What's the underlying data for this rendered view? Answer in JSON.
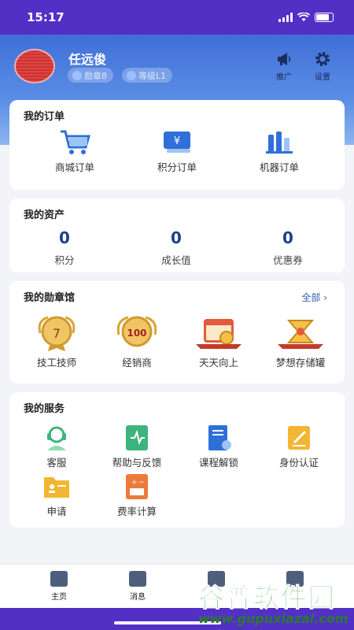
{
  "status_bar": {
    "time": "15:17"
  },
  "profile": {
    "name": "任远俊",
    "badge_pill": "勋章8",
    "level_pill": "等级L1",
    "promote_label": "推广",
    "settings_label": "设置"
  },
  "orders": {
    "title": "我的订单",
    "items": [
      {
        "label": "商城订单",
        "icon": "cart-icon"
      },
      {
        "label": "积分订单",
        "icon": "yen-card-icon"
      },
      {
        "label": "机器订单",
        "icon": "machine-icon"
      }
    ]
  },
  "assets": {
    "title": "我的资产",
    "items": [
      {
        "value": "0",
        "label": "积分"
      },
      {
        "value": "0",
        "label": "成长值"
      },
      {
        "value": "0",
        "label": "优惠券"
      }
    ]
  },
  "medals": {
    "title": "我的勋章馆",
    "more": "全部",
    "items": [
      {
        "label": "技工技师",
        "icon": "medal-7-icon"
      },
      {
        "label": "经销商",
        "icon": "medal-100-icon"
      },
      {
        "label": "天天向上",
        "icon": "calendar-medal-icon"
      },
      {
        "label": "梦想存储罐",
        "icon": "hourglass-medal-icon"
      }
    ]
  },
  "services": {
    "title": "我的服务",
    "items": [
      {
        "label": "客服",
        "icon": "headset-icon"
      },
      {
        "label": "帮助与反馈",
        "icon": "help-feedback-icon"
      },
      {
        "label": "课程解锁",
        "icon": "course-unlock-icon"
      },
      {
        "label": "身份认证",
        "icon": "id-verify-icon"
      },
      {
        "label": "申请",
        "icon": "apply-icon"
      },
      {
        "label": "费率计算",
        "icon": "calculator-icon"
      }
    ]
  },
  "tabbar": {
    "items": [
      {
        "label": "主页",
        "icon": "home-icon"
      },
      {
        "label": "消息",
        "icon": "message-icon"
      },
      {
        "label": "",
        "icon": "tab-3-icon"
      },
      {
        "label": "",
        "icon": "tab-4-icon"
      }
    ]
  },
  "watermark": {
    "line1": "谷普软件园",
    "line2": "www.gupuxlazal.com"
  },
  "colors": {
    "accent": "#2f5ab8",
    "header": "#5230c6",
    "hero": "#4a7ee0"
  }
}
